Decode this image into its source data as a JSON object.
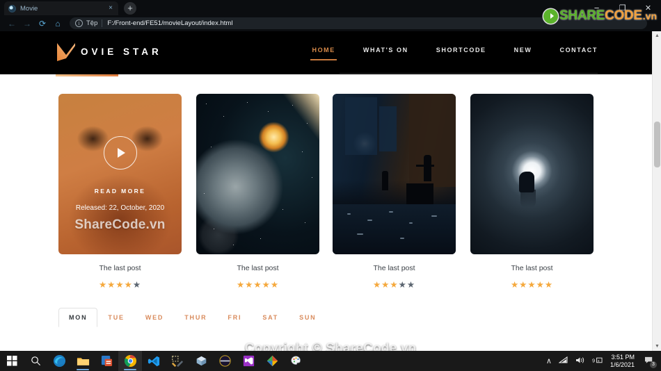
{
  "browser": {
    "tab": {
      "title": "Movie",
      "favicon_icon": "globe-icon",
      "close_icon": "×"
    },
    "new_tab_icon": "+",
    "window_controls": {
      "minimize": "−",
      "maximize": "❐",
      "close": "✕"
    },
    "nav": {
      "back_icon": "←",
      "forward_icon": "→",
      "reload_icon": "⟳",
      "home_icon": "⌂"
    },
    "omnibox": {
      "info_icon": "i",
      "scheme_label": "Tệp",
      "url": "F:/Front-end/FE51/movieLayout/index.html"
    }
  },
  "site": {
    "logo": {
      "mark": "M",
      "text": "OVIE STAR"
    },
    "nav": [
      {
        "label": "HOME",
        "active": true
      },
      {
        "label": "WHAT'S ON",
        "active": false
      },
      {
        "label": "SHORTCODE",
        "active": false
      },
      {
        "label": "NEW",
        "active": false
      },
      {
        "label": "CONTACT",
        "active": false
      }
    ],
    "cards": [
      {
        "poster": "angry-face-orange-overlay",
        "overlay": {
          "play_icon": "play-icon",
          "read_more": "READ MORE",
          "released": "Released: 22, October, 2020",
          "watermark": "ShareCode.vn"
        },
        "title": "The last post",
        "rating": 4,
        "max_rating": 5
      },
      {
        "poster": "meteor-impact-planet",
        "title": "The last post",
        "rating": 5,
        "max_rating": 5
      },
      {
        "poster": "night-city-alley-silhouettes",
        "title": "The last post",
        "rating": 3,
        "max_rating": 5
      },
      {
        "poster": "tunnel-light-silhouette",
        "title": "The last post",
        "rating": 5,
        "max_rating": 5
      }
    ],
    "day_tabs": [
      {
        "label": "MON",
        "active": true
      },
      {
        "label": "TUE",
        "active": false
      },
      {
        "label": "WED",
        "active": false
      },
      {
        "label": "THUR",
        "active": false
      },
      {
        "label": "FRI",
        "active": false
      },
      {
        "label": "SAT",
        "active": false
      },
      {
        "label": "SUN",
        "active": false
      }
    ],
    "scrollbar": {
      "up_icon": "▲",
      "down_icon": "▼"
    }
  },
  "watermarks": {
    "logo": {
      "share": "SHARE",
      "code": "CODE",
      "tld": ".vn"
    },
    "copyright": "Copyright © ShareCode.vn"
  },
  "taskbar": {
    "items": [
      {
        "name": "start-button",
        "icon": "windows-icon"
      },
      {
        "name": "search-button",
        "icon": "search-icon"
      },
      {
        "name": "taskbar-edge",
        "icon": "edge-icon"
      },
      {
        "name": "taskbar-file-explorer",
        "icon": "folder-icon"
      },
      {
        "name": "taskbar-app-red",
        "icon": "app-icon"
      },
      {
        "name": "taskbar-chrome",
        "icon": "chrome-icon"
      },
      {
        "name": "taskbar-vscode",
        "icon": "vscode-icon"
      },
      {
        "name": "taskbar-tools",
        "icon": "tools-icon"
      },
      {
        "name": "taskbar-cube",
        "icon": "cube-icon"
      },
      {
        "name": "taskbar-dark-circle",
        "icon": "circle-icon"
      },
      {
        "name": "taskbar-visual-studio",
        "icon": "visual-studio-icon"
      },
      {
        "name": "taskbar-colors",
        "icon": "colors-icon"
      },
      {
        "name": "taskbar-paint",
        "icon": "paint-icon"
      }
    ],
    "tray": {
      "chevron": "∧",
      "network_icon": "wifi-icon",
      "volume_icon": "speaker-icon",
      "input_icon": "input-indicator-icon",
      "time": "3:51 PM",
      "date": "1/6/2021",
      "notification_icon": "notification-icon",
      "notification_count": "3"
    }
  },
  "colors": {
    "accent_orange": "#d98b4a",
    "star_on": "#f5a83c",
    "star_off": "#5b6570",
    "header_bg": "#000000",
    "page_bg": "#ffffff"
  }
}
